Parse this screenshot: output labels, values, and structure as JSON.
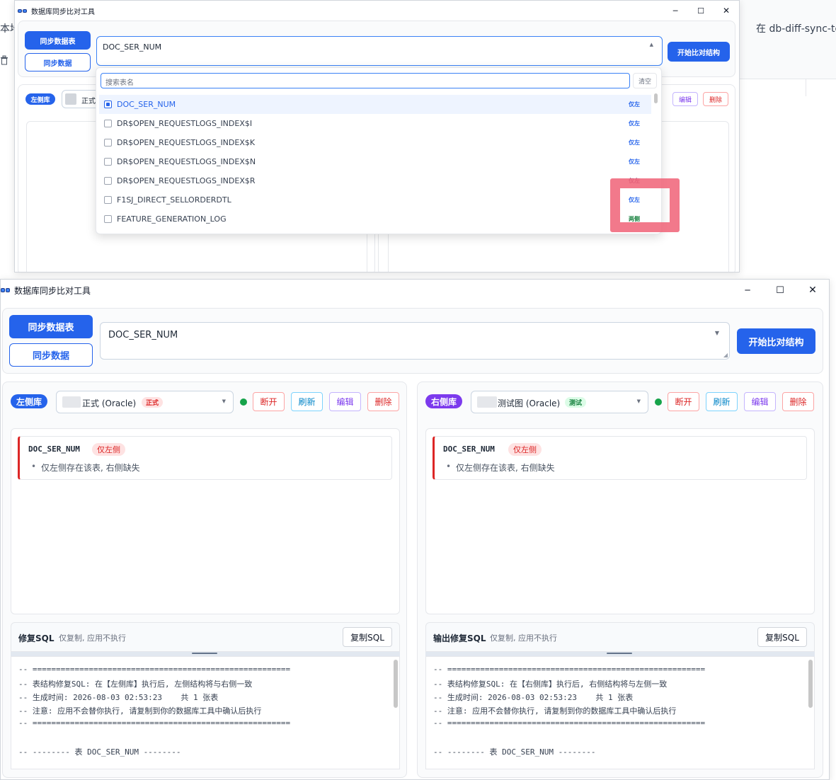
{
  "background": {
    "right_text": "在 db-diff-sync-tool",
    "left_text": "本地",
    "left_icon": "trash-icon"
  },
  "window_top": {
    "title": "数据库同步比对工具",
    "controls": {
      "minimize": "─",
      "maximize": "☐",
      "close": "✕"
    },
    "sync_table_label": "同步数据表",
    "sync_data_label": "同步数据",
    "selected_table": "DOC_SER_NUM",
    "compare_label": "开始比对结构",
    "left_db_pill": "左侧库",
    "left_db_name": "正式",
    "edit_label": "编辑",
    "delete_label": "删除",
    "dropdown": {
      "search_placeholder": "搜索表名",
      "clear_label": "清空",
      "options": [
        {
          "name": "DOC_SER_NUM",
          "tag": "仅左",
          "checked": true
        },
        {
          "name": "DR$OPEN_REQUESTLOGS_INDEX$I",
          "tag": "仅左",
          "checked": false
        },
        {
          "name": "DR$OPEN_REQUESTLOGS_INDEX$K",
          "tag": "仅左",
          "checked": false
        },
        {
          "name": "DR$OPEN_REQUESTLOGS_INDEX$N",
          "tag": "仅左",
          "checked": false
        },
        {
          "name": "DR$OPEN_REQUESTLOGS_INDEX$R",
          "tag": "仅左",
          "checked": false
        },
        {
          "name": "F1SJ_DIRECT_SELLORDERDTL",
          "tag": "仅左",
          "checked": false
        },
        {
          "name": "FEATURE_GENERATION_LOG",
          "tag": "两侧",
          "checked": false
        }
      ]
    }
  },
  "window_main": {
    "title": "数据库同步比对工具",
    "controls": {
      "minimize": "─",
      "maximize": "☐",
      "close": "✕"
    },
    "sync_table_label": "同步数据表",
    "sync_data_label": "同步数据",
    "selected_table": "DOC_SER_NUM",
    "compare_label": "开始比对结构",
    "left": {
      "pill": "左侧库",
      "db_name": "正式 (Oracle)",
      "db_badge": "正式",
      "disconnect": "断开",
      "refresh": "刷新",
      "edit": "编辑",
      "delete": "删除",
      "diff_table": "DOC_SER_NUM",
      "diff_badge": "仅左侧",
      "diff_note": "仅左侧存在该表, 右侧缺失",
      "sql_title": "修复SQL",
      "sql_hint": "仅复制, 应用不执行",
      "copy_sql": "复制SQL",
      "sql_lines": [
        "-- =======================================================",
        "-- 表结构修复SQL: 在【左侧库】执行后, 左侧结构将与右侧一致",
        "-- 生成时间: 2026-08-03 02:53:23    共 1 张表",
        "-- 注意: 应用不会替你执行, 请复制到你的数据库工具中确认后执行",
        "-- =======================================================",
        "",
        "-- -------- 表 DOC_SER_NUM --------"
      ]
    },
    "right": {
      "pill": "右侧库",
      "db_name": "测试图 (Oracle)",
      "db_badge": "测试",
      "disconnect": "断开",
      "refresh": "刷新",
      "edit": "编辑",
      "delete": "删除",
      "diff_table": "DOC_SER_NUM",
      "diff_badge": "仅左侧",
      "diff_note": "仅左侧存在该表, 右侧缺失",
      "sql_title": "输出修复SQL",
      "sql_hint": "仅复制, 应用不执行",
      "copy_sql": "复制SQL",
      "sql_lines": [
        "-- =======================================================",
        "-- 表结构修复SQL: 在【右侧库】执行后, 右侧结构将与左侧一致",
        "-- 生成时间: 2026-08-03 02:53:23    共 1 张表",
        "-- 注意: 应用不会替你执行, 请复制到你的数据库工具中确认后执行",
        "-- =======================================================",
        "",
        "-- -------- 表 DOC_SER_NUM --------"
      ]
    }
  },
  "colors": {
    "accent": "#2563eb",
    "danger": "#dc2626",
    "purple": "#7c3aed",
    "highlight": "#f06277"
  }
}
